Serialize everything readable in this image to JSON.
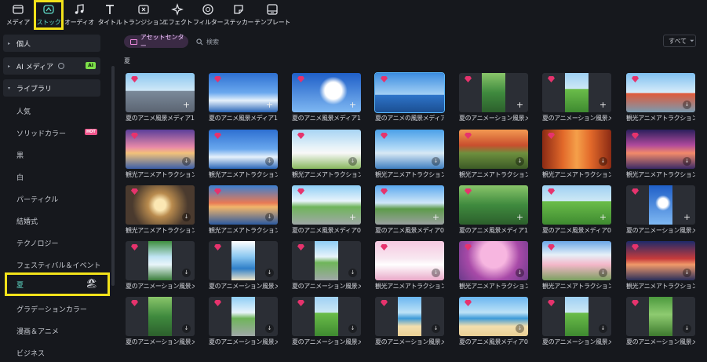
{
  "toolbar": [
    {
      "key": "media",
      "label": "メディア",
      "icon": "media-icon"
    },
    {
      "key": "stock",
      "label": "ストック",
      "icon": "stock-icon",
      "active": true
    },
    {
      "key": "audio",
      "label": "オーディオ",
      "icon": "music-note-icon"
    },
    {
      "key": "titles",
      "label": "タイトル",
      "icon": "title-t-icon"
    },
    {
      "key": "transitions",
      "label": "トランジション",
      "icon": "transition-icon"
    },
    {
      "key": "effects",
      "label": "エフェクト",
      "icon": "effects-sparkle-icon"
    },
    {
      "key": "filters",
      "label": "フィルター",
      "icon": "filter-icon"
    },
    {
      "key": "stickers",
      "label": "ステッカー",
      "icon": "sticker-icon"
    },
    {
      "key": "templates",
      "label": "テンプレート",
      "icon": "template-icon"
    }
  ],
  "sidebar": {
    "categories": [
      {
        "label": "個人"
      },
      {
        "label": "AI メディア",
        "badge": "AI"
      },
      {
        "label": "ライブラリ"
      }
    ],
    "items": [
      {
        "label": "人気"
      },
      {
        "label": "ソリッドカラー",
        "badge": "HOT"
      },
      {
        "label": "黒"
      },
      {
        "label": "白"
      },
      {
        "label": "パーティクル"
      },
      {
        "label": "結婚式"
      },
      {
        "label": "テクノロジー"
      },
      {
        "label": "フェスティバル＆イベント"
      },
      {
        "label": "夏",
        "selected": true,
        "emoji": "🏖"
      },
      {
        "label": "グラデーションカラー"
      },
      {
        "label": "漫画＆アニメ"
      },
      {
        "label": "ビジネス"
      }
    ]
  },
  "main": {
    "asset_center": "アセットセンター",
    "search_placeholder": "検索",
    "filter_label": "すべて",
    "section": "夏",
    "rows": [
      [
        {
          "cap": "夏のアニメ風景メディア13",
          "kind": "full",
          "action": "plus",
          "scene": "city"
        },
        {
          "cap": "夏のアニメ風景メディア12",
          "kind": "full",
          "action": "plus",
          "scene": "sky"
        },
        {
          "cap": "夏のアニメ風景メディア11",
          "kind": "full",
          "action": "plus",
          "scene": "clouds"
        },
        {
          "cap": "夏のアニメの風景メディア02",
          "kind": "full",
          "action": "none",
          "scene": "lighthouse",
          "selected": true
        },
        {
          "cap": "夏のアニメーション風景メ...",
          "kind": "port",
          "action": "plus",
          "scene": "forest"
        },
        {
          "cap": "夏のアニメーション風景メ...",
          "kind": "port",
          "action": "plus",
          "scene": "field"
        },
        {
          "cap": "観光アニメアトラクションメ...",
          "kind": "full",
          "action": "dl",
          "scene": "tower"
        }
      ],
      [
        {
          "cap": "観光アニメアトラクションメ...",
          "kind": "full",
          "action": "dl",
          "scene": "sunset"
        },
        {
          "cap": "観光アニメアトラクションメ...",
          "kind": "full",
          "action": "dl",
          "scene": "sky"
        },
        {
          "cap": "観光アニメアトラクションメ...",
          "kind": "full",
          "action": "dl",
          "scene": "flowers"
        },
        {
          "cap": "観光アニメアトラクションメ...",
          "kind": "full",
          "action": "dl",
          "scene": "torii"
        },
        {
          "cap": "観光アニメアトラクションメ...",
          "kind": "full",
          "action": "dl",
          "scene": "deer"
        },
        {
          "cap": "観光アニメアトラクションメ...",
          "kind": "full",
          "action": "dl",
          "scene": "shrine"
        },
        {
          "cap": "観光アニメアトラクションメ...",
          "kind": "full",
          "action": "dl",
          "scene": "nightcity"
        }
      ],
      [
        {
          "cap": "観光アニメアトラクションメ...",
          "kind": "full",
          "action": "dl",
          "scene": "tunnel"
        },
        {
          "cap": "観光アニメアトラクションメ...",
          "kind": "full",
          "action": "dl",
          "scene": "seatorii"
        },
        {
          "cap": "夏のアニメ風景メディア05",
          "kind": "full",
          "action": "plus",
          "scene": "street"
        },
        {
          "cap": "夏のアニメ風景メディア04",
          "kind": "full",
          "action": "plus",
          "scene": "signal"
        },
        {
          "cap": "夏のアニメ風景メディア14",
          "kind": "full",
          "action": "plus",
          "scene": "forest"
        },
        {
          "cap": "夏のアニメ風景メディア07",
          "kind": "full",
          "action": "plus",
          "scene": "field"
        },
        {
          "cap": "夏のアニメーション風景メ...",
          "kind": "port",
          "action": "plus",
          "scene": "clouds"
        }
      ],
      [
        {
          "cap": "夏のアニメーション風景メ...",
          "kind": "port",
          "action": "dl",
          "scene": "waterfall"
        },
        {
          "cap": "夏のアニメーション風景メ...",
          "kind": "port",
          "action": "dl",
          "scene": "sea"
        },
        {
          "cap": "夏のアニメーション風景メ...",
          "kind": "port",
          "action": "dl",
          "scene": "street"
        },
        {
          "cap": "観光アニメアトラクションメ...",
          "kind": "full",
          "action": "dl",
          "scene": "castle"
        },
        {
          "cap": "観光アニメアトラクションメ...",
          "kind": "full",
          "action": "dl",
          "scene": "blossom"
        },
        {
          "cap": "観光アニメアトラクションメ...",
          "kind": "full",
          "action": "dl",
          "scene": "fuji"
        },
        {
          "cap": "観光アニメアトラクションメ...",
          "kind": "full",
          "action": "dl",
          "scene": "pagoda"
        }
      ],
      [
        {
          "cap": "夏のアニメーション風景メ...",
          "kind": "port",
          "action": "dl",
          "scene": "forest"
        },
        {
          "cap": "夏のアニメーション風景メ...",
          "kind": "port",
          "action": "dl",
          "scene": "street"
        },
        {
          "cap": "夏のアニメーション風景メ...",
          "kind": "port",
          "action": "dl",
          "scene": "field"
        },
        {
          "cap": "夏のアニメーション風景メ...",
          "kind": "port",
          "action": "dl",
          "scene": "beach"
        },
        {
          "cap": "夏のアニメ風景メディア01",
          "kind": "full",
          "action": "dl",
          "scene": "beach"
        },
        {
          "cap": "夏のアニメーション風景メ...",
          "kind": "port",
          "action": "dl",
          "scene": "field"
        },
        {
          "cap": "夏のアニメーション風景メ...",
          "kind": "port",
          "action": "dl",
          "scene": "train"
        }
      ]
    ]
  },
  "colors": {
    "accent_active": "#5fd9c7",
    "highlight": "#f2e21a",
    "premium_gem": "#e6336d",
    "asset_center_bg": "#3a2a44"
  }
}
